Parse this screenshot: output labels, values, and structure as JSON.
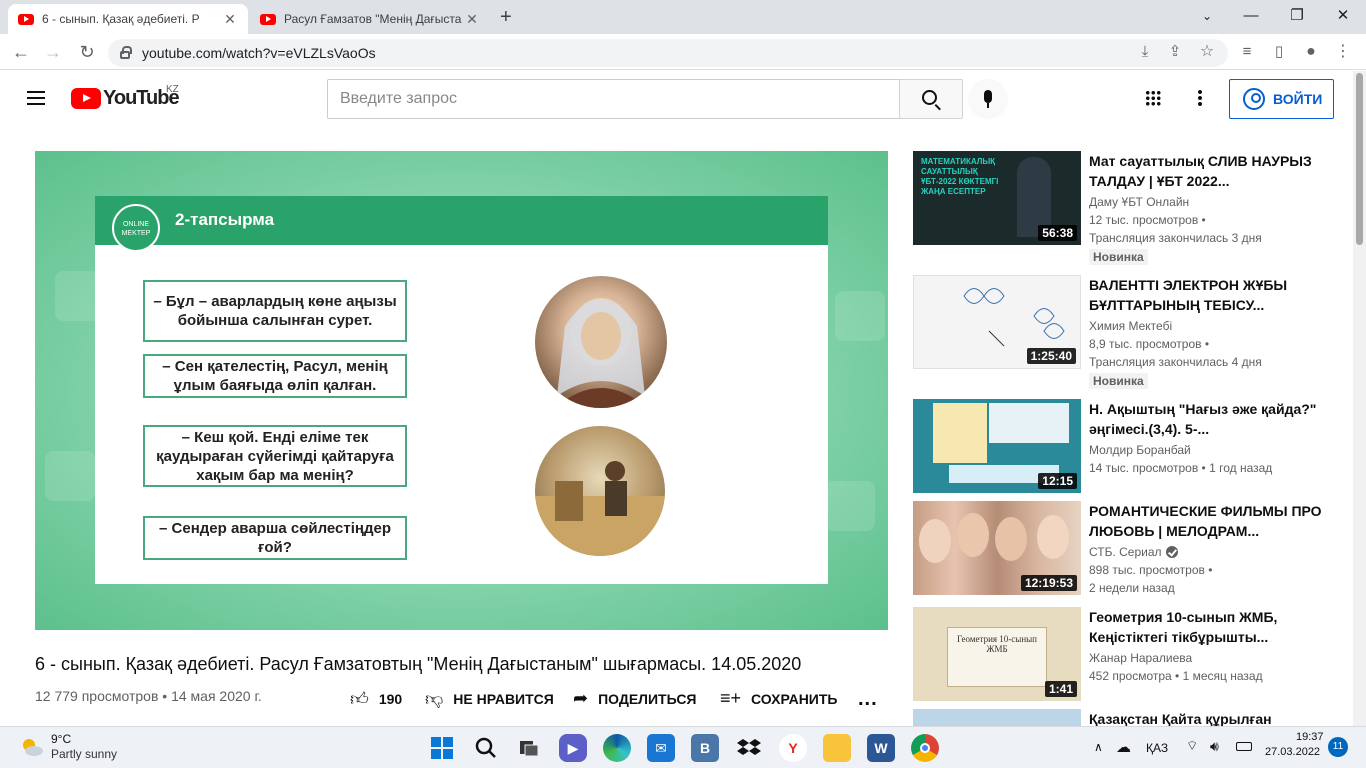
{
  "browser": {
    "tabs": [
      {
        "title": "6 - сынып. Қазақ әдебиеті. Р",
        "active": true
      },
      {
        "title": "Расул Ғамзатов \"Менің Дағыста",
        "active": false
      }
    ],
    "new_tab": "+",
    "url": "youtube.com/watch?v=eVLZLsVaoOs"
  },
  "youtube": {
    "logo_text": "YouTube",
    "country": "KZ",
    "search_placeholder": "Введите запрос",
    "signin_label": "ВОЙТИ"
  },
  "slide": {
    "badge": "ONLINE MEKTEP",
    "heading": "2-тапсырма",
    "quotes": [
      "– Бұл – аварлардың көне аңызы бойынша салынған сурет.",
      "– Сен қателестің, Расул, менің ұлым баяғыда өліп қалған.",
      "– Кеш қой. Енді еліме тек қаудыраған сүйегімді қайтаруға хақым бар ма менің?",
      "– Сендер аварша сөйлестіңдер ғой?"
    ]
  },
  "video": {
    "title": "6 - сынып. Қазақ әдебиеті. Расул Ғамзатовтың \"Менің Дағыстаным\" шығармасы. 14.05.2020",
    "views": "12 779 просмотров",
    "date": "14 мая 2020 г.",
    "likes": "190",
    "dislike_label": "НЕ НРАВИТСЯ",
    "share_label": "ПОДЕЛИТЬСЯ",
    "save_label": "СОХРАНИТЬ",
    "more": "..."
  },
  "recommendations": [
    {
      "title": "Мат сауаттылық СЛИВ НАУРЫЗ ТАЛДАУ | ҰБТ 2022...",
      "channel": "Даму ҰБТ Онлайн",
      "views": "12 тыс. просмотров",
      "extra": "Трансляция закончилась 3 дня",
      "badge": "Новинка",
      "duration": "56:38",
      "thumb_text": "МАТЕМАТИКАЛЫҚ САУАТТЫЛЫҚ ҰБТ-2022 КӨКТЕМГІ ЖАҢА ЕСЕПТЕР",
      "thumb_color": "#1b2a2a"
    },
    {
      "title": "ВАЛЕНТТІ ЭЛЕКТРОН ЖҰБЫ БҰЛТТАРЫНЫҢ ТЕБІСУ...",
      "channel": "Химия Мектебі",
      "views": "8,9 тыс. просмотров",
      "extra": "Трансляция закончилась 4 дня",
      "badge": "Новинка",
      "duration": "1:25:40",
      "thumb_color": "#f4f4f4"
    },
    {
      "title": "Н. Ақыштың \"Нағыз әже қайда?\" әңгімесі.(3,4). 5-...",
      "channel": "Молдир Боранбай",
      "views": "14 тыс. просмотров",
      "extra": "1 год назад",
      "duration": "12:15",
      "thumb_color": "#2a8a9a"
    },
    {
      "title": "РОМАНТИЧЕСКИЕ ФИЛЬМЫ ПРО ЛЮБОВЬ | МЕЛОДРАМ...",
      "channel": "СТБ. Сериал",
      "views": "898 тыс. просмотров",
      "extra": "2 недели назад",
      "duration": "12:19:53",
      "thumb_color": "#c9a58a"
    },
    {
      "title": "Геометрия 10-сынып ЖМБ, Кеңістіктегі тікбұрышты...",
      "channel": "Жанар Наралиева",
      "views": "452 просмотра",
      "extra": "1 месяц назад",
      "duration": "1:41",
      "thumb_text": "Геометрия 10-сынып ЖМБ",
      "thumb_color": "#e8dcc0"
    },
    {
      "title": "Қазақстан Қайта құрылған",
      "thumb_color": "#bcd6e8"
    }
  ],
  "taskbar": {
    "weather_temp": "9°C",
    "weather_desc": "Partly sunny",
    "language": "ҚАЗ",
    "time": "19:37",
    "date": "27.03.2022",
    "notifications": "11"
  }
}
